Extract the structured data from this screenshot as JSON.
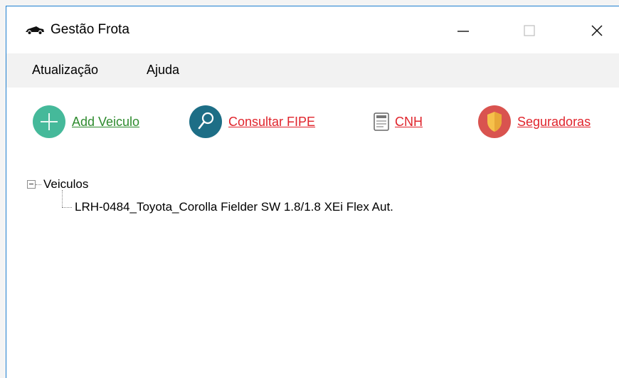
{
  "window": {
    "title": "Gestão Frota",
    "app_icon": "car-icon",
    "controls": {
      "minimize": "minimize-icon",
      "maximize": "maximize-icon",
      "close": "close-icon"
    }
  },
  "menu": {
    "items": [
      "Atualização",
      "Ajuda"
    ]
  },
  "toolbar": {
    "add_vehicle": {
      "label": "Add Veiculo",
      "icon": "plus-icon"
    },
    "consult_fipe": {
      "label": "Consultar FIPE",
      "icon": "search-icon"
    },
    "cnh": {
      "label": "CNH",
      "icon": "document-icon"
    },
    "insurers": {
      "label": "Seguradoras",
      "icon": "shield-icon"
    }
  },
  "tree": {
    "root": {
      "label": "Veiculos",
      "expanded": true
    },
    "children": [
      {
        "label": "LRH-0484_Toyota_Corolla Fielder SW 1.8/1.8 XEi Flex Aut."
      }
    ]
  },
  "colors": {
    "link_green": "#2e8b2e",
    "link_red": "#e0242c",
    "add_icon": "#45b99a",
    "search_icon": "#1d6e86",
    "shield_icon_outer": "#d9534f",
    "shield_icon_inner": "#f6c14b",
    "window_border": "#1e7fd0"
  }
}
